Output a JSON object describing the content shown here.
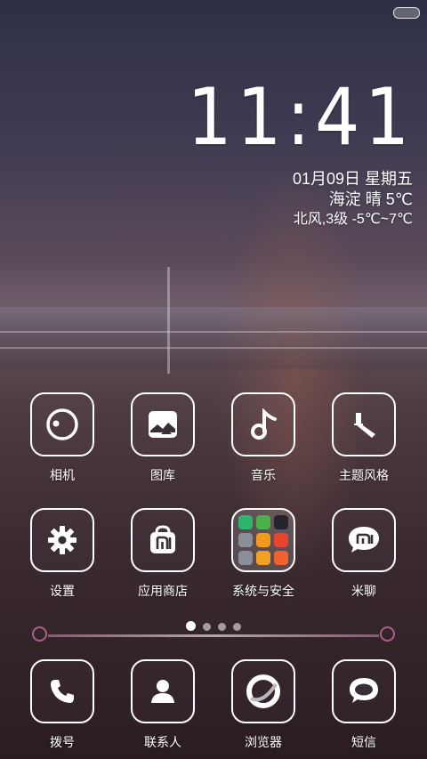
{
  "clock": {
    "time": "11:41"
  },
  "date_line": "01月09日 星期五",
  "weather_line": "海淀 晴 5℃",
  "wind_line": "北风,3级 -5℃~7℃",
  "apps_row1": [
    {
      "name": "camera",
      "label": "相机",
      "icon": "camera-lens-icon"
    },
    {
      "name": "gallery",
      "label": "图库",
      "icon": "gallery-icon"
    },
    {
      "name": "music",
      "label": "音乐",
      "icon": "music-note-icon"
    },
    {
      "name": "themes",
      "label": "主题风格",
      "icon": "brush-icon"
    }
  ],
  "apps_row2": [
    {
      "name": "settings",
      "label": "设置",
      "icon": "gear-icon"
    },
    {
      "name": "app-store",
      "label": "应用商店",
      "icon": "shopping-bag-icon"
    },
    {
      "name": "system-security-folder",
      "label": "系统与安全",
      "icon": "folder-icon"
    },
    {
      "name": "miliao",
      "label": "米聊",
      "icon": "chat-bubble-icon"
    }
  ],
  "dock": [
    {
      "name": "phone",
      "label": "拨号",
      "icon": "phone-icon"
    },
    {
      "name": "contacts",
      "label": "联系人",
      "icon": "person-icon"
    },
    {
      "name": "browser",
      "label": "浏览器",
      "icon": "browser-icon"
    },
    {
      "name": "messages",
      "label": "短信",
      "icon": "message-bubble-icon"
    }
  ],
  "folder_mini_colors": [
    "#2fb46c",
    "#4cb04a",
    "#23242e",
    "#8b8f99",
    "#f39a1a",
    "#e8452f",
    "#8a8f99",
    "#f2a022",
    "#f0622e"
  ],
  "page_indicator": {
    "count": 4,
    "active": 1
  }
}
